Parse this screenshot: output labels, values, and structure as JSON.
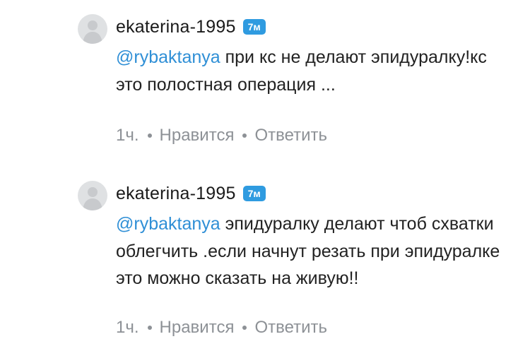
{
  "comments": [
    {
      "author": "ekaterina-1995",
      "badge": "7м",
      "mention": "@rybaktanya",
      "text": " при кс не делают эпидуралку!кс это полостная операция ...",
      "time": "1ч.",
      "like_label": "Нравится",
      "reply_label": "Ответить"
    },
    {
      "author": "ekaterina-1995",
      "badge": "7м",
      "mention": "@rybaktanya",
      "text": " эпидуралку делают чтоб схватки облегчить  .если начнут резать при эпидуралке это можно сказать на живую!!",
      "time": "1ч.",
      "like_label": "Нравится",
      "reply_label": "Ответить"
    }
  ],
  "colors": {
    "mention": "#2f8fd6",
    "badge": "#2f9be0",
    "meta": "#8d9196"
  },
  "icons": {
    "avatar": "user-silhouette-icon"
  }
}
